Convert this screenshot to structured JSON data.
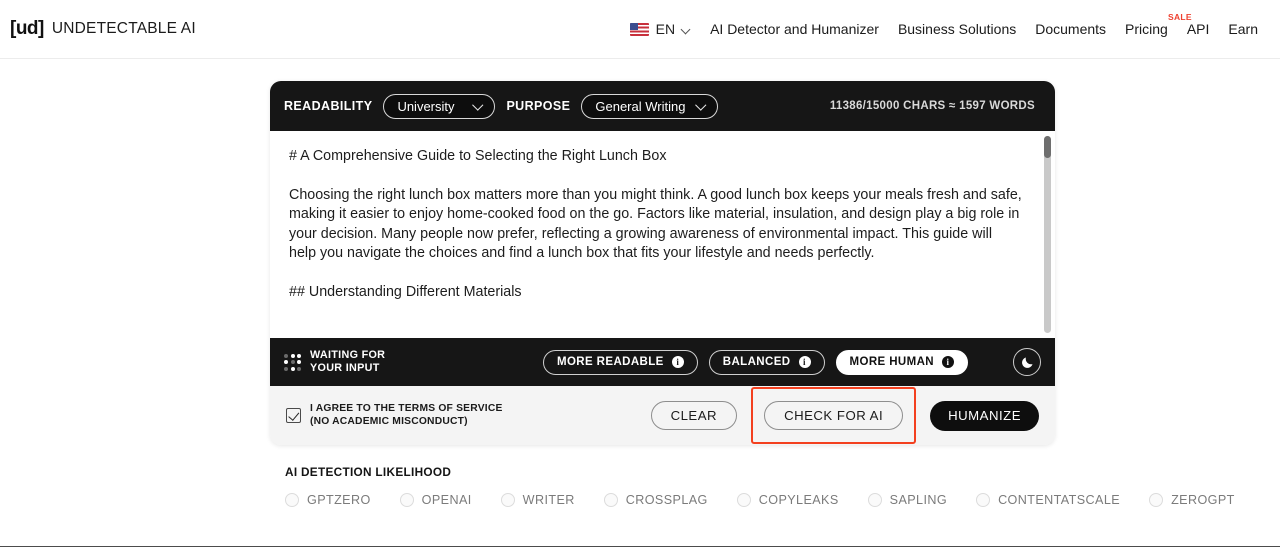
{
  "header": {
    "logo_mark": "[ud]",
    "logo_name": "UNDETECTABLE AI",
    "language": {
      "code": "EN",
      "flag_icon": "us-flag-icon",
      "chevron_icon": "chevron-down-icon"
    },
    "nav": [
      {
        "label": "AI Detector and Humanizer",
        "badge": ""
      },
      {
        "label": "Business Solutions",
        "badge": ""
      },
      {
        "label": "Documents",
        "badge": ""
      },
      {
        "label": "Pricing",
        "badge": "SALE"
      },
      {
        "label": "API",
        "badge": ""
      },
      {
        "label": "Earn",
        "badge": ""
      }
    ]
  },
  "toolbar": {
    "readability_label": "READABILITY",
    "readability_value": "University",
    "purpose_label": "PURPOSE",
    "purpose_value": "General Writing",
    "char_count": "11386/15000 CHARS ≈ 1597 WORDS"
  },
  "editor": {
    "paragraphs": [
      "# A Comprehensive Guide to Selecting the Right Lunch Box",
      "Choosing the right lunch box matters more than you might think. A good lunch box keeps your meals fresh and safe, making it easier to enjoy home-cooked food on the go. Factors like material, insulation, and design play a big role in your decision. Many people now prefer, reflecting a growing awareness of environmental impact. This guide will help you navigate the choices and find a lunch box that fits your lifestyle and needs perfectly.",
      "## Understanding Different Materials"
    ]
  },
  "status": {
    "icon": "dot-grid-icon",
    "line1": "WAITING FOR",
    "line2": "YOUR INPUT",
    "modes": [
      {
        "label": "MORE READABLE",
        "active": false,
        "info_icon": "info-icon"
      },
      {
        "label": "BALANCED",
        "active": false,
        "info_icon": "info-icon"
      },
      {
        "label": "MORE HUMAN",
        "active": true,
        "info_icon": "info-icon"
      }
    ],
    "theme_toggle_icon": "moon-icon"
  },
  "actions": {
    "checkbox_checked": true,
    "agree_line1": "I AGREE TO THE TERMS OF SERVICE",
    "agree_line2": "(NO ACADEMIC MISCONDUCT)",
    "clear_label": "CLEAR",
    "check_label": "CHECK FOR AI",
    "humanize_label": "HUMANIZE",
    "highlight_color": "#f3401f"
  },
  "detection": {
    "title": "AI DETECTION LIKELIHOOD",
    "detectors": [
      {
        "name": "GPTZERO",
        "state": "empty"
      },
      {
        "name": "OPENAI",
        "state": "empty"
      },
      {
        "name": "WRITER",
        "state": "empty"
      },
      {
        "name": "CROSSPLAG",
        "state": "empty"
      },
      {
        "name": "COPYLEAKS",
        "state": "empty"
      },
      {
        "name": "SAPLING",
        "state": "empty"
      },
      {
        "name": "CONTENTATSCALE",
        "state": "empty"
      },
      {
        "name": "ZEROGPT",
        "state": "empty"
      }
    ]
  }
}
